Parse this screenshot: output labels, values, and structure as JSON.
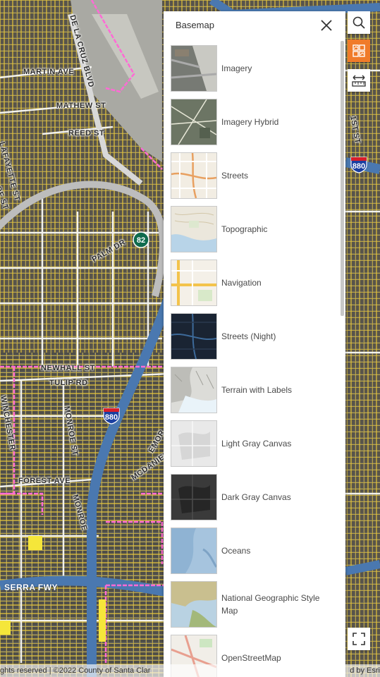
{
  "map": {
    "streets": [
      {
        "name": "MARTIN AVE"
      },
      {
        "name": "MATHEW ST"
      },
      {
        "name": "REED ST"
      },
      {
        "name": "LAFAYETTE ST"
      },
      {
        "name": "DE LA CRUZ BLVD"
      },
      {
        "name": "PALM DR"
      },
      {
        "name": "NEWHALL ST"
      },
      {
        "name": "TULIP RD"
      },
      {
        "name": "MONROE ST"
      },
      {
        "name": "FOREST AVE"
      },
      {
        "name": "MCDANIEL"
      },
      {
        "name": "SERRA FWY"
      },
      {
        "name": "1ST ST"
      },
      {
        "name": "OF ST"
      },
      {
        "name": "WINCHESTER"
      },
      {
        "name": "MONROE"
      },
      {
        "name": "EMOR"
      }
    ],
    "shields": {
      "route_82": "82",
      "interstate_880_a": "880",
      "interstate_880_b": "880"
    },
    "attribution_left": "ghts reserved | ©2022 County of Santa Clar",
    "attribution_right": "d by Esri"
  },
  "panel": {
    "title": "Basemap",
    "close_icon": "close-icon",
    "items": [
      {
        "label": "Imagery",
        "thumb": "imagery"
      },
      {
        "label": "Imagery Hybrid",
        "thumb": "imagery-hybrid"
      },
      {
        "label": "Streets",
        "thumb": "streets"
      },
      {
        "label": "Topographic",
        "thumb": "topographic"
      },
      {
        "label": "Navigation",
        "thumb": "navigation"
      },
      {
        "label": "Streets (Night)",
        "thumb": "streets-night"
      },
      {
        "label": "Terrain with Labels",
        "thumb": "terrain"
      },
      {
        "label": "Light Gray Canvas",
        "thumb": "light-gray"
      },
      {
        "label": "Dark Gray Canvas",
        "thumb": "dark-gray"
      },
      {
        "label": "Oceans",
        "thumb": "oceans"
      },
      {
        "label": "National Geographic Style Map",
        "thumb": "natgeo"
      },
      {
        "label": "OpenStreetMap",
        "thumb": "osm"
      }
    ]
  },
  "tools": {
    "search": "search-icon",
    "basemap": "basemap-gallery-icon",
    "measure": "measure-icon",
    "fullscreen": "fullscreen-icon"
  },
  "colors": {
    "accent": "#f07b2a",
    "parcel_line": "#e8c93a",
    "freeway": "#4a78b0",
    "boundary": "#ff6ad5"
  }
}
